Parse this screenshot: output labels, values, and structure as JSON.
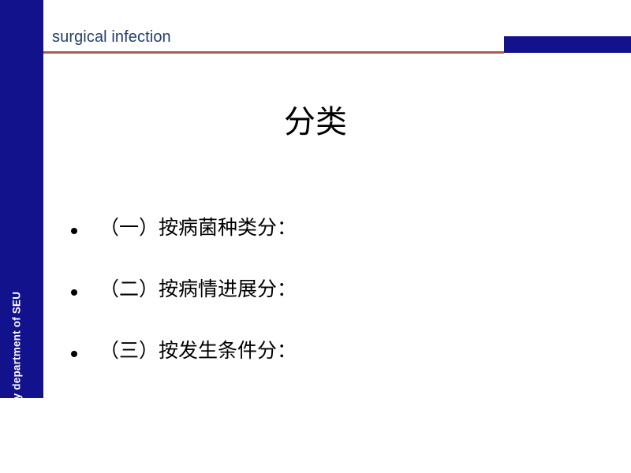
{
  "slide": {
    "header": {
      "title": "surgical infection",
      "rule_color": "#ad5a57",
      "block_color": "#12128c"
    },
    "sidebar": {
      "label": "General surgery department of  SEU",
      "background_color": "#12128c",
      "text_color": "#ffffff"
    },
    "body": {
      "title": "分类",
      "bullets": [
        {
          "marker": "bullet-dot",
          "text": "（一）按病菌种类分："
        },
        {
          "marker": "bullet-dot",
          "text": "（二）按病情进展分："
        },
        {
          "marker": "bullet-dot",
          "text": "（三）按发生条件分："
        }
      ]
    },
    "colors": {
      "background": "#ffffff",
      "accent_navy": "#12128c",
      "header_text": "#24406b",
      "rule_red": "#ad5a57",
      "body_text": "#000000"
    }
  }
}
